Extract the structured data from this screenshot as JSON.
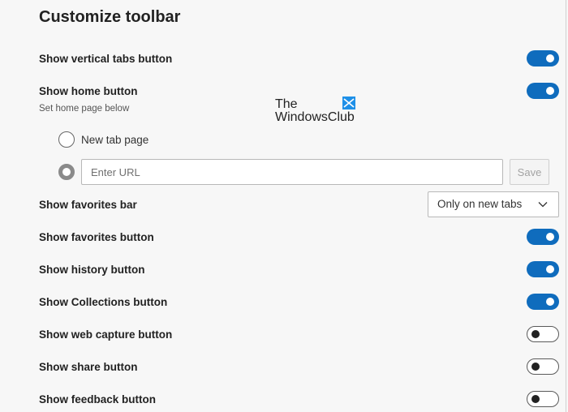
{
  "section_title": "Customize toolbar",
  "rows": {
    "vertical_tabs": {
      "label": "Show vertical tabs button",
      "on": true
    },
    "home": {
      "label": "Show home button",
      "on": true,
      "sub": "Set home page below"
    },
    "favorites_bar": {
      "label": "Show favorites bar"
    },
    "favorites": {
      "label": "Show favorites button",
      "on": true
    },
    "history": {
      "label": "Show history button",
      "on": true
    },
    "collections": {
      "label": "Show Collections button",
      "on": true
    },
    "web_capture": {
      "label": "Show web capture button",
      "on": false
    },
    "share": {
      "label": "Show share button",
      "on": false
    },
    "feedback": {
      "label": "Show feedback button",
      "on": false
    }
  },
  "home_options": {
    "new_tab_label": "New tab page",
    "url_placeholder": "Enter URL",
    "url_value": "",
    "save_label": "Save"
  },
  "favorites_bar_select": {
    "selected": "Only on new tabs"
  },
  "watermark": {
    "line1": "The",
    "line2": "WindowsClub"
  },
  "colors": {
    "accent": "#0f6cbd",
    "logo_blue": "#1e90e8"
  },
  "icons": {
    "dropdown": "chevron-down-icon",
    "logo": "windows-logo-icon"
  }
}
